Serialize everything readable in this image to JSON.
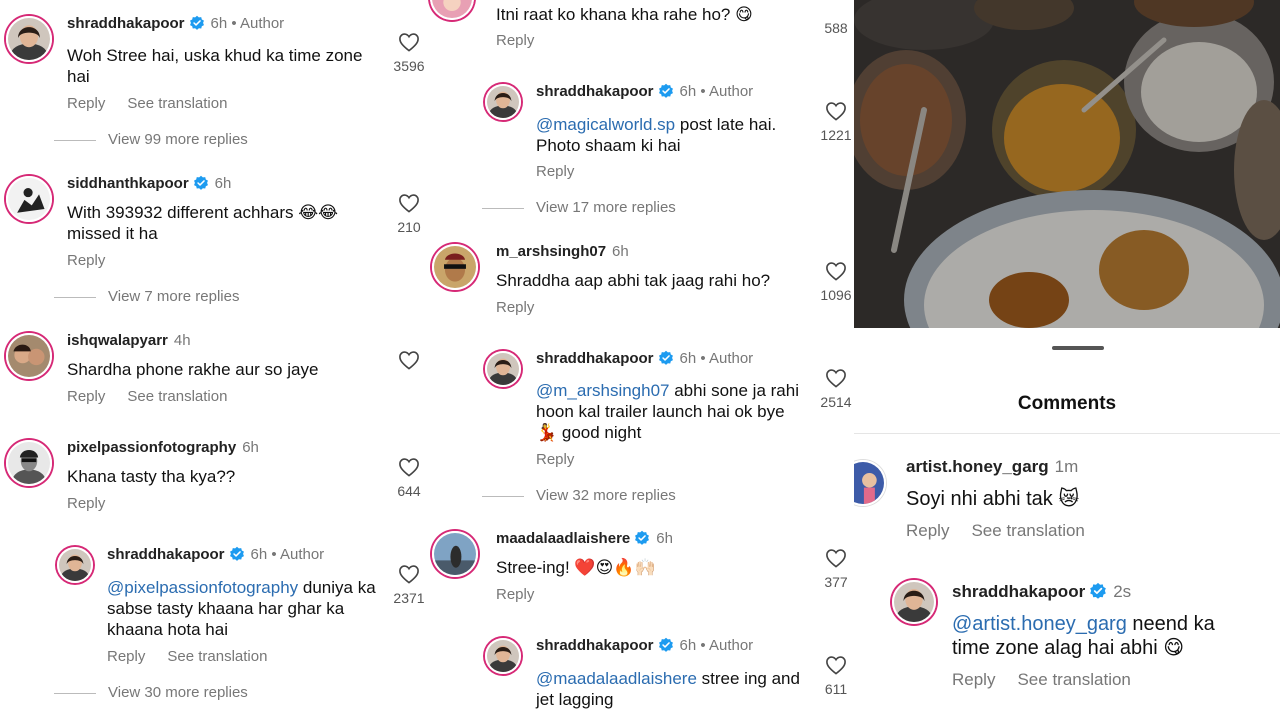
{
  "left": {
    "c1": {
      "username": "shraddhakapoor",
      "time": "6h",
      "author": "• Author",
      "text": "Woh Stree hai, uska khud ka time zone hai",
      "reply": "Reply",
      "translate": "See translation",
      "more": "View 99 more replies",
      "likes": "3596"
    },
    "c2": {
      "username": "siddhanthkapoor",
      "time": "6h",
      "text": "With 393932  different achhars 😂😂 missed it ha",
      "reply": "Reply",
      "more": "View 7 more replies",
      "likes": "210"
    },
    "c3": {
      "username": "ishqwalapyarr",
      "time": "4h",
      "text": "Shardha phone rakhe aur so jaye",
      "reply": "Reply",
      "translate": "See translation"
    },
    "c4": {
      "username": "pixelpassionfotography",
      "time": "6h",
      "text": "Khana tasty tha kya??",
      "reply": "Reply",
      "likes": "644"
    },
    "c5": {
      "username": "shraddhakapoor",
      "time": "6h",
      "author": "• Author",
      "mention": "@pixelpassionfotography",
      "text": " duniya ka sabse tasty khaana har ghar ka khaana hota hai",
      "reply": "Reply",
      "translate": "See translation",
      "more": "View 30 more replies",
      "likes": "2371"
    }
  },
  "mid": {
    "c0": {
      "text": "Itni raat ko khana kha rahe ho? 😋",
      "reply": "Reply",
      "likes": "588"
    },
    "c1": {
      "username": "shraddhakapoor",
      "time": "6h",
      "author": "• Author",
      "mention": "@magicalworld.sp",
      "text": " post late hai. Photo shaam ki hai",
      "reply": "Reply",
      "more": "View 17 more replies",
      "likes": "1221"
    },
    "c2": {
      "username": "m_arshsingh07",
      "time": "6h",
      "text": "Shraddha aap abhi tak jaag rahi ho?",
      "reply": "Reply",
      "likes": "1096"
    },
    "c3": {
      "username": "shraddhakapoor",
      "time": "6h",
      "author": "• Author",
      "mention": "@m_arshsingh07",
      "text": " abhi sone ja rahi hoon kal trailer launch hai ok bye 💃 good night",
      "reply": "Reply",
      "more": "View 32 more replies",
      "likes": "2514"
    },
    "c4": {
      "username": "maadalaadlaishere",
      "time": "6h",
      "text": "Stree-ing! ❤️😍🔥🙌🏻",
      "reply": "Reply",
      "likes": "377"
    },
    "c5": {
      "username": "shraddhakapoor",
      "time": "6h",
      "author": "• Author",
      "mention": "@maadalaadlaishere",
      "text": " stree ing and jet lagging",
      "likes": "611"
    }
  },
  "right": {
    "title": "Comments",
    "c1": {
      "username": "artist.honey_garg",
      "time": "1m",
      "text": "Soyi nhi abhi tak 😿",
      "reply": "Reply",
      "translate": "See translation"
    },
    "c2": {
      "username": "shraddhakapoor",
      "time": "2s",
      "mention": "@artist.honey_garg",
      "text": " neend ka time zone alag hai abhi 😋",
      "reply": "Reply",
      "translate": "See translation"
    }
  },
  "colors": {
    "mention": "#2b6cb0",
    "verified": "#1d9bf0",
    "story_ring": "#d62976"
  }
}
